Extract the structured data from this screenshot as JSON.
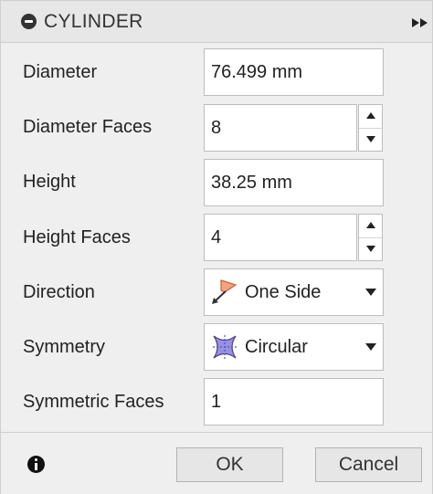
{
  "header": {
    "title": "CYLINDER"
  },
  "rows": [
    {
      "label": "Diameter",
      "value": "76.499 mm"
    },
    {
      "label": "Diameter Faces",
      "value": "8"
    },
    {
      "label": "Height",
      "value": "38.25 mm"
    },
    {
      "label": "Height Faces",
      "value": "4"
    },
    {
      "label": "Direction",
      "value": "One Side",
      "icon": "one-side-direction-icon"
    },
    {
      "label": "Symmetry",
      "value": "Circular",
      "icon": "circular-symmetry-icon"
    },
    {
      "label": "Symmetric Faces",
      "value": "1"
    }
  ],
  "footer": {
    "ok_label": "OK",
    "cancel_label": "Cancel"
  },
  "icons": {
    "collapse": "minus-circle-icon",
    "expand": "double-chevron-right-icon",
    "info": "info-icon"
  },
  "colors": {
    "direction_flag": "#f2a47d",
    "symmetry_fill": "#9b8fe0"
  }
}
